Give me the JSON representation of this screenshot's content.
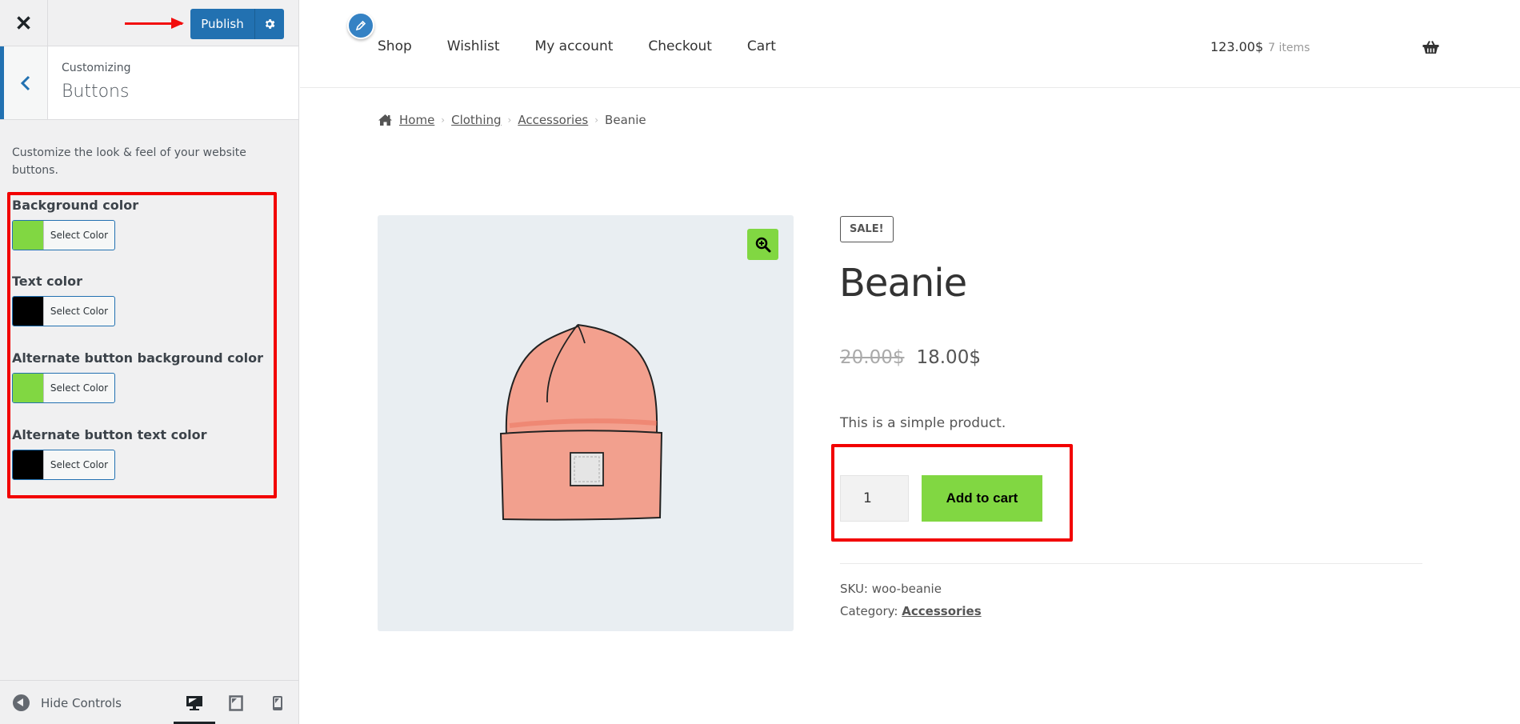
{
  "customizer": {
    "close_label": "Close",
    "publish_label": "Publish",
    "section": {
      "breadcrumb": "Customizing",
      "title": "Buttons"
    },
    "description": "Customize the look & feel of your website buttons.",
    "controls": [
      {
        "label": "Background color",
        "button_label": "Select Color",
        "color": "#81d742"
      },
      {
        "label": "Text color",
        "button_label": "Select Color",
        "color": "#000000"
      },
      {
        "label": "Alternate button background color",
        "button_label": "Select Color",
        "color": "#81d742"
      },
      {
        "label": "Alternate button text color",
        "button_label": "Select Color",
        "color": "#000000"
      }
    ],
    "footer": {
      "hide_controls_label": "Hide Controls",
      "devices": [
        "desktop",
        "tablet",
        "mobile"
      ],
      "active_device": "desktop"
    }
  },
  "site": {
    "nav": [
      "Shop",
      "Wishlist",
      "My account",
      "Checkout",
      "Cart"
    ],
    "cart": {
      "total": "123.00$",
      "count": "7 items"
    },
    "breadcrumb": {
      "items": [
        "Home",
        "Clothing",
        "Accessories"
      ],
      "current": "Beanie"
    }
  },
  "product": {
    "badge": "SALE!",
    "title": "Beanie",
    "regular_price": "20.00$",
    "sale_price": "18.00$",
    "short_description": "This is a simple product.",
    "quantity": "1",
    "add_to_cart_label": "Add to cart",
    "sku_label": "SKU:",
    "sku": "woo-beanie",
    "category_label": "Category:",
    "category": "Accessories"
  },
  "colors": {
    "wp_blue": "#2271b1",
    "button_green": "#81d742",
    "annotation_red": "#f20000"
  }
}
